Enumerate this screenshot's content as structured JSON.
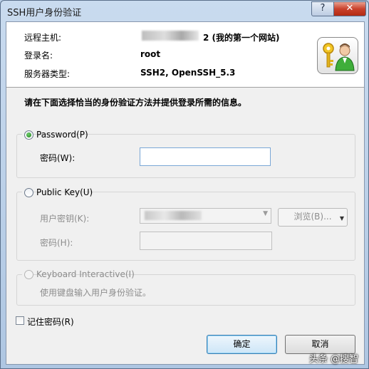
{
  "window": {
    "title": "SSH用户身份验证",
    "help_label": "?",
    "close_label": "✕"
  },
  "header": {
    "host_label": "远程主机:",
    "host_value": "2 (我的第一个网站)",
    "user_label": "登录名:",
    "user_value": "root",
    "server_label": "服务器类型:",
    "server_value": "SSH2, OpenSSH_5.3"
  },
  "instruction": "请在下面选择恰当的身份验证方法并提供登录所需的信息。",
  "password_group": {
    "radio_label": "Password(P)",
    "selected": true,
    "field_label": "密码(W):",
    "field_value": ""
  },
  "publickey_group": {
    "radio_label": "Public Key(U)",
    "selected": false,
    "key_label": "用户密钥(K):",
    "browse_label": "浏览(B)...",
    "passphrase_label": "密码(H):",
    "passphrase_value": ""
  },
  "keyboard_group": {
    "radio_label": "Keyboard Interactive(I)",
    "selected": false,
    "description": "使用键盘输入用户身份验证。"
  },
  "remember_password": {
    "label": "记住密码(R)",
    "checked": false
  },
  "buttons": {
    "ok": "确定",
    "cancel": "取消"
  },
  "watermark": "头条 @搜智",
  "icons": {
    "header": "keys-user-icon",
    "browse_dropdown": "dropdown-arrow-icon",
    "combo_arrow": "chevron-down-icon"
  },
  "colors": {
    "title_bar": "#c9dbef",
    "close_button": "#c9412c",
    "ok_border": "#3c7fb1"
  }
}
